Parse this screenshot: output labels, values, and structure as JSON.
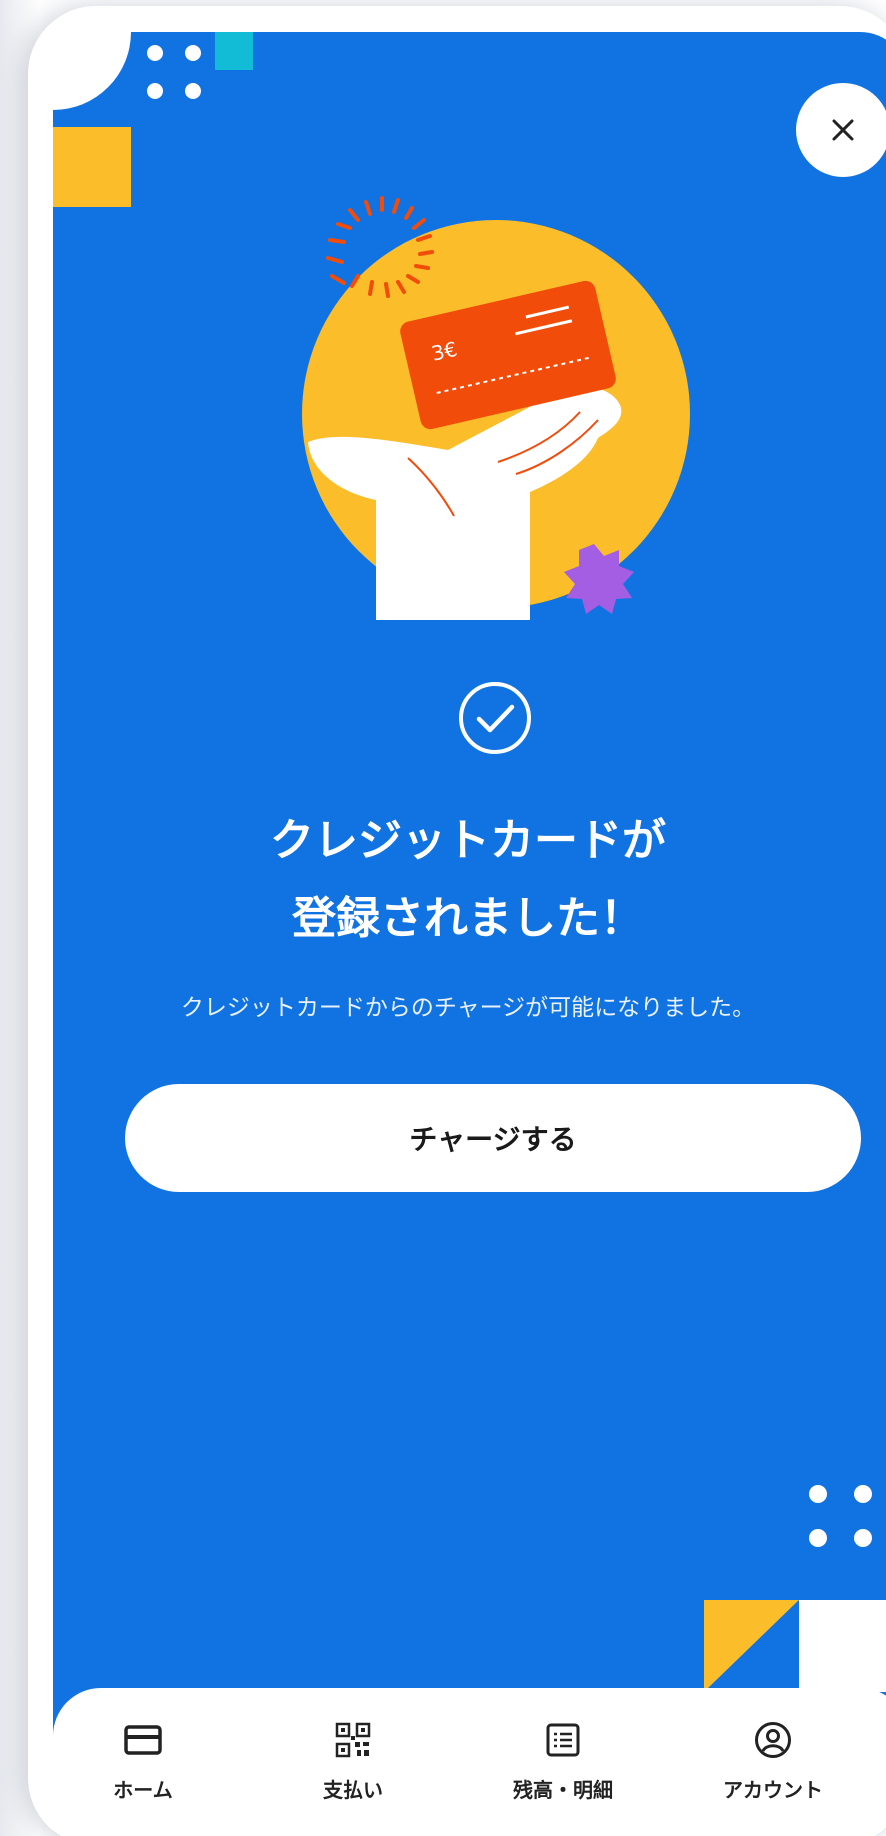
{
  "colors": {
    "background_blue": "#1173e1",
    "accent_yellow": "#fbbd29",
    "card_orange": "#f24c0b",
    "teal": "#13bcd6",
    "purple": "#a35ee3",
    "pink": "#f681a8",
    "green": "#14a882",
    "red": "#e2452d"
  },
  "header": {
    "close_icon": "close-icon"
  },
  "illustration": {
    "icon": "hand-holding-credit-card"
  },
  "status": {
    "icon": "check-circle-icon"
  },
  "message": {
    "title_line1": "クレジットカードが",
    "title_line2": "登録されました！",
    "subtitle": "クレジットカードからのチャージが可能になりました。"
  },
  "actions": {
    "charge_label": "チャージする"
  },
  "bottom_nav": {
    "items": [
      {
        "label": "ホーム",
        "icon": "card-icon"
      },
      {
        "label": "支払い",
        "icon": "qr-code-icon"
      },
      {
        "label": "残高・明細",
        "icon": "statement-icon"
      },
      {
        "label": "アカウント",
        "icon": "account-icon"
      }
    ]
  }
}
